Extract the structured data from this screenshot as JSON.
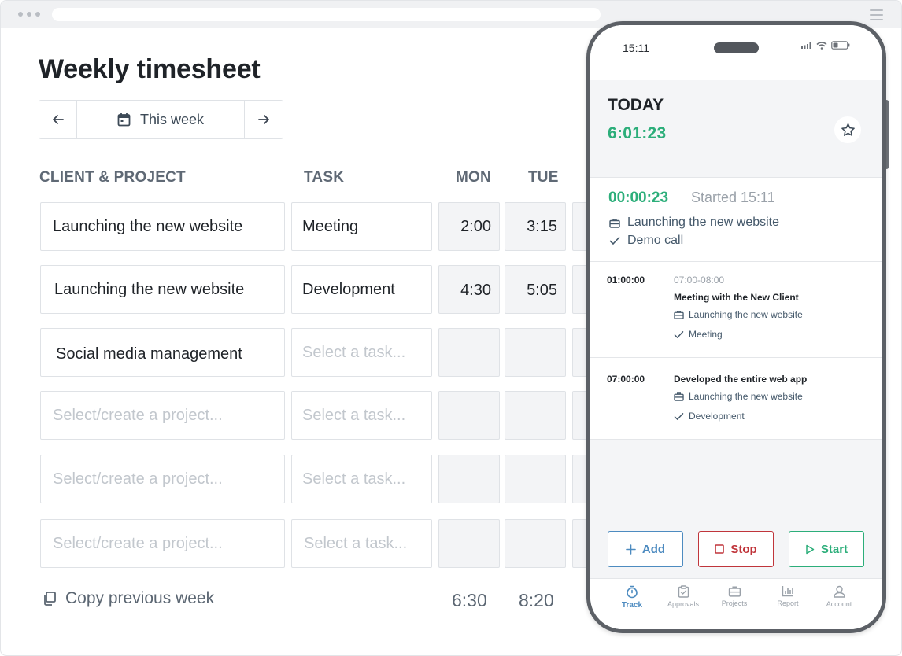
{
  "timesheet": {
    "title": "Weekly timesheet",
    "week_label": "This week",
    "headers": {
      "project": "CLIENT & PROJECT",
      "task": "TASK",
      "mon": "MON",
      "tue": "TUE"
    },
    "rows": [
      {
        "project": "Launching the new website",
        "task": "Meeting",
        "mon": "2:00",
        "tue": "3:15"
      },
      {
        "project": "Launching the new website",
        "task": "Development",
        "mon": "4:30",
        "tue": "5:05"
      },
      {
        "project": "Social media management",
        "task": "",
        "mon": "",
        "tue": ""
      },
      {
        "project": "",
        "task": "",
        "mon": "",
        "tue": ""
      },
      {
        "project": "",
        "task": "",
        "mon": "",
        "tue": ""
      },
      {
        "project": "",
        "task": "",
        "mon": "",
        "tue": ""
      }
    ],
    "project_placeholder": "Select/create a project...",
    "task_placeholder": "Select a task...",
    "copy_previous": "Copy previous week",
    "totals": {
      "mon": "6:30",
      "tue": "8:20"
    }
  },
  "phone": {
    "status_time": "15:11",
    "today_label": "TODAY",
    "today_total": "6:01:23",
    "running": {
      "timer": "00:00:23",
      "started": "Started 15:11",
      "project": "Launching the new website",
      "task": "Demo call"
    },
    "entries": [
      {
        "duration": "01:00:00",
        "range": "07:00-08:00",
        "title": "Meeting with the New Client",
        "project": "Launching the new website",
        "task": "Meeting"
      },
      {
        "duration": "07:00:00",
        "range": "",
        "title": "Developed the entire web app",
        "project": "Launching the new website",
        "task": "Development"
      }
    ],
    "actions": {
      "add": "Add",
      "stop": "Stop",
      "start": "Start"
    },
    "tabs": [
      "Track",
      "Approvals",
      "Projects",
      "Report",
      "Account"
    ]
  },
  "colors": {
    "accent_green": "#2cae7a",
    "accent_blue": "#4d8bc0",
    "stop_red": "#c0353b"
  },
  "icons": [
    "arrow-left-icon",
    "calendar-icon",
    "arrow-right-icon",
    "copy-icon",
    "star-icon",
    "briefcase-icon",
    "check-icon",
    "plus-icon",
    "stop-icon",
    "play-icon",
    "stopwatch-icon",
    "clipboard-check-icon",
    "bar-chart-icon",
    "user-icon"
  ]
}
